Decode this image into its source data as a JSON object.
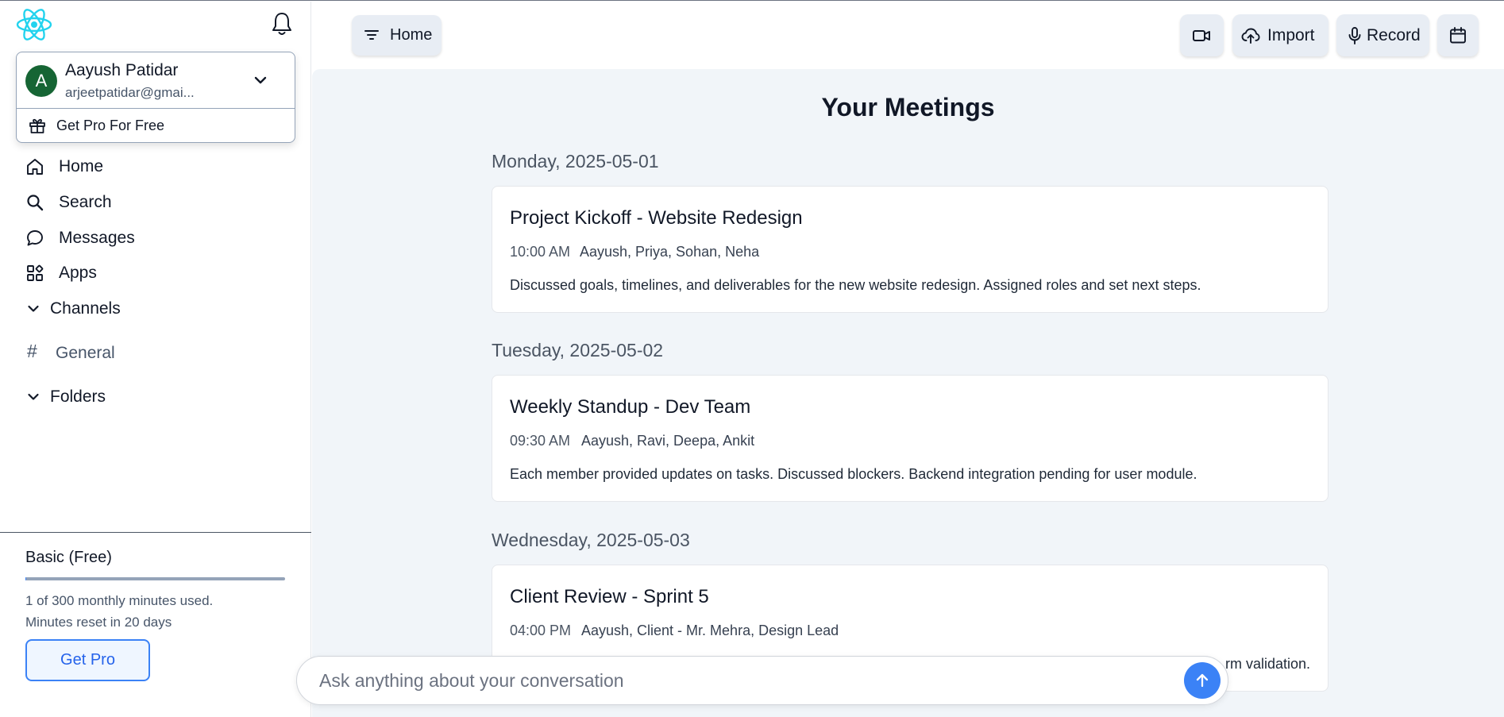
{
  "user": {
    "initial": "A",
    "name": "Aayush Patidar",
    "email": "arjeetpatidar@gmai...",
    "get_pro_label": "Get Pro For Free"
  },
  "nav": {
    "home": "Home",
    "search": "Search",
    "messages": "Messages",
    "apps": "Apps",
    "channels": "Channels",
    "channel_general": "General",
    "folders": "Folders"
  },
  "plan": {
    "title": "Basic (Free)",
    "used_minutes": 1,
    "total_minutes": 300,
    "usage_text": "1 of 300 monthly minutes used.",
    "reset_text": "Minutes reset in 20 days",
    "button": "Get Pro"
  },
  "topbar": {
    "home_label": "Home",
    "import_label": "Import",
    "record_label": "Record"
  },
  "main": {
    "title": "Your Meetings",
    "days": [
      {
        "label": "Monday,  2025-05-01",
        "meeting": {
          "title": "Project Kickoff - Website Redesign",
          "time": "10:00 AM",
          "participants": "Aayush, Priya, Sohan, Neha",
          "summary": "Discussed goals, timelines, and deliverables for the new website redesign. Assigned roles and set next steps."
        }
      },
      {
        "label": "Tuesday,  2025-05-02",
        "meeting": {
          "title": "Weekly Standup - Dev Team",
          "time": "09:30 AM",
          "participants": "Aayush, Ravi, Deepa, Ankit",
          "summary": "Each member provided updates on tasks. Discussed blockers. Backend integration pending for user module."
        }
      },
      {
        "label": "Wednesday,  2025-05-03",
        "meeting": {
          "title": "Client Review - Sprint 5",
          "time": "04:00 PM",
          "participants": "Aayush, Client - Mr. Mehra, Design Lead",
          "summary_visible_tail": "rm validation."
        }
      }
    ]
  },
  "chat": {
    "placeholder": "Ask anything about your conversation"
  },
  "colors": {
    "accent": "#3b82f6",
    "avatar": "#166534",
    "logo": "#22d3ee",
    "main_bg": "#f1f5f9"
  },
  "icons": {
    "logo": "react-logo",
    "bell": "bell-icon",
    "home": "home-icon",
    "search": "search-icon",
    "messages": "message-bubble-icon",
    "apps": "apps-grid-icon",
    "filter": "filter-icon",
    "video": "video-camera-icon",
    "import": "cloud-upload-icon",
    "record": "microphone-icon",
    "calendar": "calendar-icon",
    "send": "arrow-up-icon"
  }
}
